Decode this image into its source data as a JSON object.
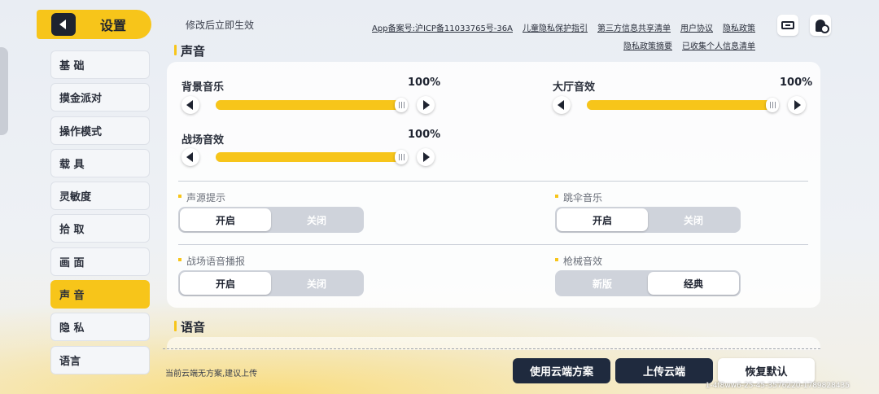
{
  "header": {
    "title": "设置",
    "back_icon": "back-arrow-icon"
  },
  "notice": "修改后立即生效",
  "links": {
    "row1": [
      "App备案号:沪ICP备11033765号-36A",
      "儿童隐私保护指引",
      "第三方信息共享清单",
      "用户协议",
      "隐私政策"
    ],
    "row2": [
      "隐私政策摘要",
      "已收集个人信息清单"
    ]
  },
  "top_icons": [
    "ticket-icon",
    "user-settings-icon"
  ],
  "sidebar": {
    "items": [
      {
        "label": "基 础"
      },
      {
        "label": "摸金派对"
      },
      {
        "label": "操作模式"
      },
      {
        "label": "载 具"
      },
      {
        "label": "灵敏度"
      },
      {
        "label": "拾 取"
      },
      {
        "label": "画 面"
      },
      {
        "label": "声 音"
      },
      {
        "label": "隐 私"
      },
      {
        "label": "语言"
      }
    ],
    "active": "声 音"
  },
  "sections": {
    "sound": "声音",
    "voice": "语音"
  },
  "sliders": [
    {
      "label": "背景音乐",
      "value": "100%",
      "level": 1.0
    },
    {
      "label": "大厅音效",
      "value": "100%",
      "level": 1.0
    },
    {
      "label": "战场音效",
      "value": "100%",
      "level": 1.0
    }
  ],
  "toggles": [
    {
      "label": "声源提示",
      "options": [
        "开启",
        "关闭"
      ],
      "selected": "开启"
    },
    {
      "label": "跳伞音乐",
      "options": [
        "开启",
        "关闭"
      ],
      "selected": "开启"
    },
    {
      "label": "战场语音播报",
      "options": [
        "开启",
        "关闭"
      ],
      "selected": "开启"
    },
    {
      "label": "枪械音效",
      "options": [
        "新版",
        "经典"
      ],
      "selected": "经典"
    }
  ],
  "footer": {
    "cloud_hint": "当前云端无方案,建议上传",
    "use_cloud": "使用云端方案",
    "upload_cloud": "上传云端",
    "restore_default": "恢复默认",
    "build_id": "1-4f8ww6-25-45-3576220-1789828435"
  },
  "colors": {
    "accent": "#f7c51a",
    "dark": "#1f2a3e",
    "track": "#d6dae2"
  }
}
